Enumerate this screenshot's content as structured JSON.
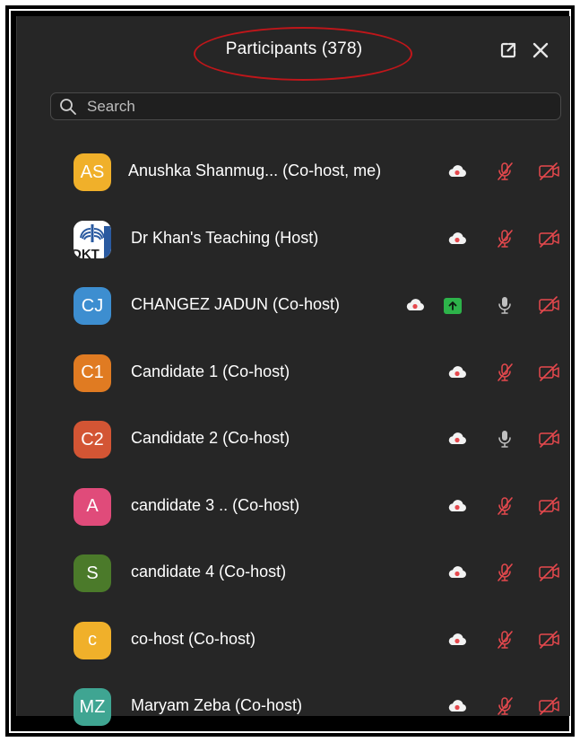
{
  "panel": {
    "title": "Participants (378)"
  },
  "search": {
    "placeholder": "Search",
    "value": ""
  },
  "participants": [
    {
      "initials": "AS",
      "name": "Anushka Shanmug... (Co-host, me)",
      "avatar_color": "#f0b02a",
      "mic": "muted",
      "video": "off",
      "cloud": true
    },
    {
      "initials": "",
      "logo_text": "DKT",
      "name": "Dr Khan's Teaching (Host)",
      "avatar_color": "#ffffff",
      "mic": "muted",
      "video": "off",
      "cloud": true
    },
    {
      "initials": "CJ",
      "name": "CHANGEZ JADUN (Co-host)",
      "avatar_color": "#3d8ed0",
      "mic": "unmuted",
      "video": "off",
      "cloud": true,
      "screen_share": true
    },
    {
      "initials": "C1",
      "name": "Candidate 1 (Co-host)",
      "avatar_color": "#e07b22",
      "mic": "muted",
      "video": "off",
      "cloud": true
    },
    {
      "initials": "C2",
      "name": "Candidate 2 (Co-host)",
      "avatar_color": "#d35534",
      "mic": "unmuted",
      "video": "off",
      "cloud": true
    },
    {
      "initials": "A",
      "name": "candidate 3 .. (Co-host)",
      "avatar_color": "#e04b7a",
      "mic": "muted",
      "video": "off",
      "cloud": true
    },
    {
      "initials": "S",
      "name": "candidate 4 (Co-host)",
      "avatar_color": "#4b7a2a",
      "mic": "muted",
      "video": "off",
      "cloud": true
    },
    {
      "initials": "c",
      "name": "co-host (Co-host)",
      "avatar_color": "#f0b02a",
      "mic": "muted",
      "video": "off",
      "cloud": true
    },
    {
      "initials": "MZ",
      "name": "Maryam Zeba (Co-host)",
      "avatar_color": "#3fa592",
      "mic": "muted",
      "video": "off",
      "cloud": true
    }
  ],
  "colors": {
    "panel_bg": "#262626",
    "muted_red": "#e5484d",
    "annotation_ring": "#c0161a",
    "share_green": "#2db34a"
  },
  "icons": [
    "popout-icon",
    "close-icon",
    "search-icon",
    "cloud-record-icon",
    "mic-muted-icon",
    "mic-icon",
    "video-off-icon",
    "screen-share-icon"
  ]
}
